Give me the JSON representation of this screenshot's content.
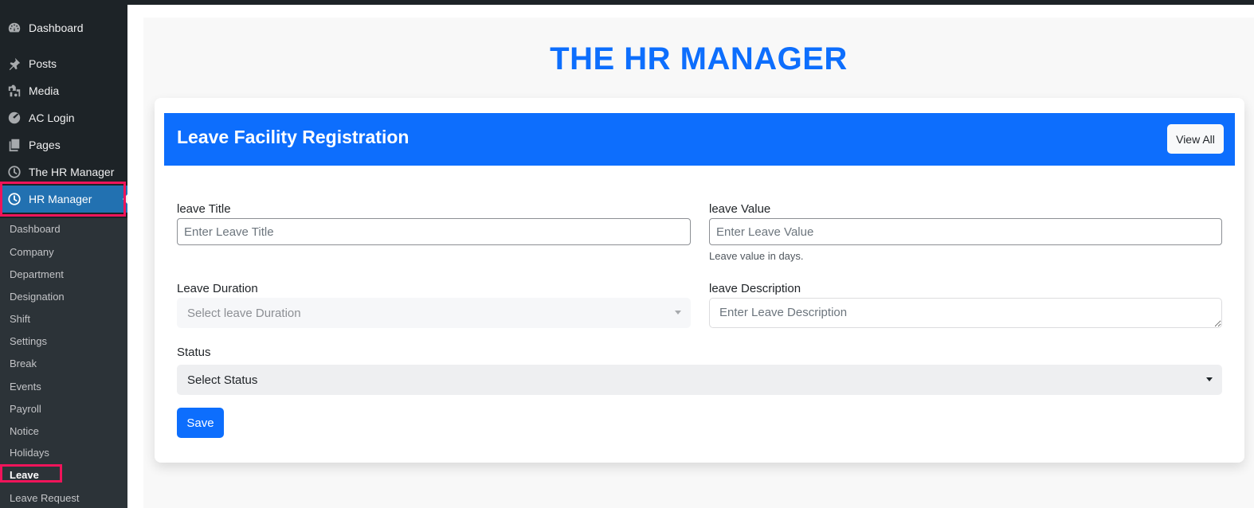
{
  "sidebar": {
    "items": [
      {
        "label": "Dashboard",
        "icon": "dashboard-icon"
      },
      {
        "label": "Posts",
        "icon": "pin-icon"
      },
      {
        "label": "Media",
        "icon": "media-icon"
      },
      {
        "label": "AC Login",
        "icon": "palette-icon"
      },
      {
        "label": "Pages",
        "icon": "pages-icon"
      },
      {
        "label": "The HR Manager",
        "icon": "clock-icon"
      },
      {
        "label": "HR Manager",
        "icon": "clock-icon",
        "active": true
      }
    ],
    "submenu": [
      {
        "label": "Dashboard"
      },
      {
        "label": "Company"
      },
      {
        "label": "Department"
      },
      {
        "label": "Designation"
      },
      {
        "label": "Shift"
      },
      {
        "label": "Settings"
      },
      {
        "label": "Break"
      },
      {
        "label": "Events"
      },
      {
        "label": "Payroll"
      },
      {
        "label": "Notice"
      },
      {
        "label": "Holidays"
      },
      {
        "label": "Leave",
        "current": true
      },
      {
        "label": "Leave Request"
      }
    ]
  },
  "header": {
    "title": "THE HR MANAGER"
  },
  "card": {
    "title": "Leave Facility Registration",
    "view_all_label": "View All"
  },
  "form": {
    "leave_title": {
      "label": "leave Title",
      "placeholder": "Enter Leave Title",
      "value": ""
    },
    "leave_value": {
      "label": "leave Value",
      "placeholder": "Enter Leave Value",
      "value": "",
      "help": "Leave value in days."
    },
    "leave_duration": {
      "label": "Leave Duration",
      "selected": "Select leave Duration"
    },
    "leave_description": {
      "label": "leave Description",
      "placeholder": "Enter Leave Description",
      "value": ""
    },
    "status": {
      "label": "Status",
      "selected": "Select Status"
    },
    "save_label": "Save"
  },
  "colors": {
    "primary": "#0d6efd",
    "sidebar_bg": "#1d2327",
    "submenu_bg": "#2c3338",
    "active_menu": "#2271b1",
    "highlight": "#f0145a"
  }
}
